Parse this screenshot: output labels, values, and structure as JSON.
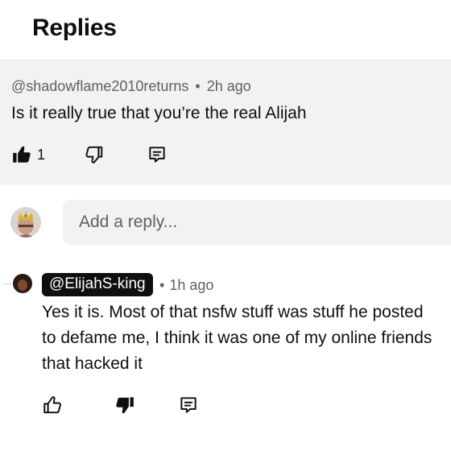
{
  "header": {
    "title": "Replies"
  },
  "parent_comment": {
    "handle": "@shadowflame2010returns",
    "separator": "•",
    "time": "2h ago",
    "text": "Is it really true that you’re the real Alijah",
    "like_count": "1",
    "icons": {
      "like": "thumbs-up-filled-icon",
      "dislike": "thumbs-down-outline-icon",
      "reply": "comment-icon"
    }
  },
  "reply_box": {
    "placeholder": "Add a reply..."
  },
  "reply": {
    "handle": "@ElijahS-king",
    "separator": "•",
    "time": "1h ago",
    "text": "Yes it is. Most of that nsfw stuff was stuff he posted to defame me, I think it was one of my online friends that hacked it",
    "icons": {
      "like": "thumbs-up-outline-icon",
      "dislike": "thumbs-down-filled-icon",
      "reply": "comment-icon"
    }
  },
  "colors": {
    "panel_bg": "#f2f2f2",
    "meta_text": "#606060",
    "badge_bg": "#0f0f0f"
  }
}
